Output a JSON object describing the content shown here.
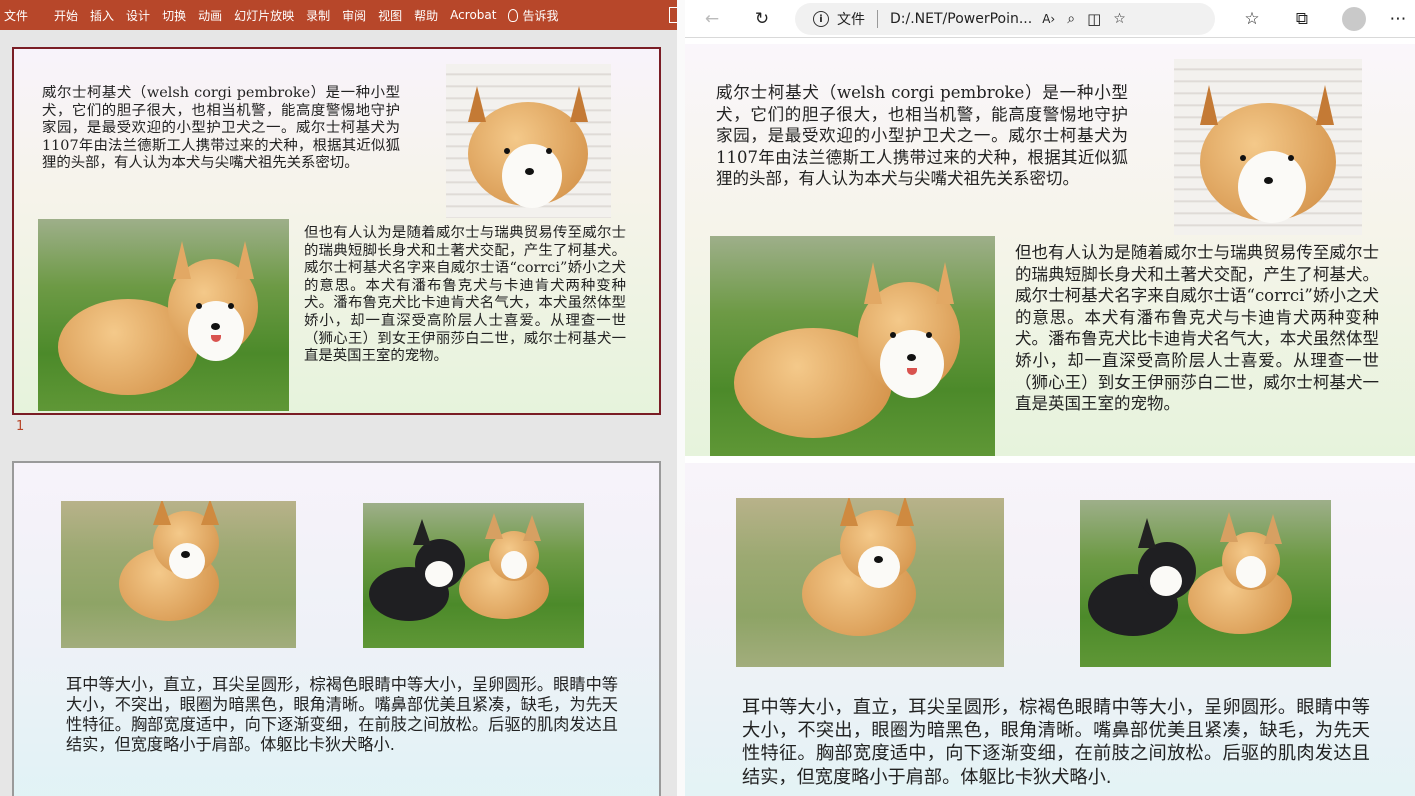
{
  "ppt": {
    "ribbon_tabs": [
      "文件",
      "开始",
      "插入",
      "设计",
      "切换",
      "动画",
      "幻灯片放映",
      "录制",
      "审阅",
      "视图",
      "帮助",
      "Acrobat"
    ],
    "tell_me": "告诉我",
    "slide1_number": "1",
    "slide1": {
      "para1": "威尔士柯基犬（welsh corgi pembroke）是一种小型犬，它们的胆子很大，也相当机警，能高度警惕地守护家园，是最受欢迎的小型护卫犬之一。威尔士柯基犬为1107年由法兰德斯工人携带过来的犬种，根据其近似狐狸的头部，有人认为本犬与尖嘴犬祖先关系密切。",
      "para2": "但也有人认为是随着威尔士与瑞典贸易传至威尔士的瑞典短脚长身犬和土著犬交配，产生了柯基犬。威尔士柯基犬名字来自威尔士语“corrci”娇小之犬的意思。本犬有潘布鲁克犬与卡迪肯犬两种变种犬。潘布鲁克犬比卡迪肯犬名气大，本犬虽然体型娇小，却一直深受高阶层人士喜爱。从理查一世（狮心王）到女王伊丽莎白二世，威尔士柯基犬一直是英国王室的宠物。"
    },
    "slide2": {
      "para": "耳中等大小，直立，耳尖呈圆形，棕褐色眼睛中等大小，呈卵圆形。眼睛中等大小，不突出，眼圈为暗黑色，眼角清晰。嘴鼻部优美且紧凑，缺毛，为先天性特征。胸部宽度适中，向下逐渐变细，在前肢之间放松。后驱的肌肉发达且结实，但宽度略小于肩部。体躯比卡狄犬略小."
    }
  },
  "browser": {
    "address_label": "文件",
    "address_url": "D:/.NET/PowerPoin...",
    "icons": [
      "back-icon",
      "refresh-icon",
      "info-icon",
      "read-aloud-icon",
      "zoom-icon",
      "split-screen-icon",
      "favorite-add-icon",
      "favorites-icon",
      "collections-icon",
      "profile-icon",
      "more-icon"
    ],
    "sec1": {
      "para1": "威尔士柯基犬（welsh corgi pembroke）是一种小型犬，它们的胆子很大，也相当机警，能高度警惕地守护家园，是最受欢迎的小型护卫犬之一。威尔士柯基犬为1107年由法兰德斯工人携带过来的犬种，根据其近似狐狸的头部，有人认为本犬与尖嘴犬祖先关系密切。",
      "para2": "但也有人认为是随着威尔士与瑞典贸易传至威尔士的瑞典短脚长身犬和土著犬交配，产生了柯基犬。威尔士柯基犬名字来自威尔士语“corrci”娇小之犬的意思。本犬有潘布鲁克犬与卡迪肯犬两种变种犬。潘布鲁克犬比卡迪肯犬名气大，本犬虽然体型娇小，却一直深受高阶层人士喜爱。从理查一世（狮心王）到女王伊丽莎白二世，威尔士柯基犬一直是英国王室的宠物。"
    },
    "sec2": {
      "para": "耳中等大小，直立，耳尖呈圆形，棕褐色眼睛中等大小，呈卵圆形。眼睛中等大小，不突出，眼圈为暗黑色，眼角清晰。嘴鼻部优美且紧凑，缺毛，为先天性特征。胸部宽度适中，向下逐渐变细，在前肢之间放松。后驱的肌肉发达且结实，但宽度略小于肩部。体躯比卡狄犬略小."
    }
  }
}
